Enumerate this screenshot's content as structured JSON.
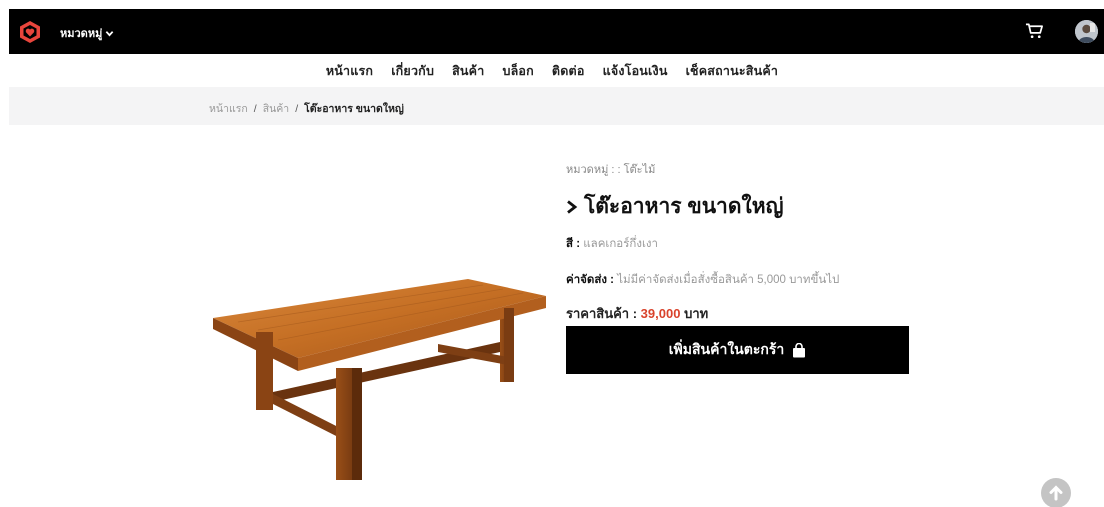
{
  "topbar": {
    "category_label": "หมวดหมู่",
    "logo_color": "#e8453c"
  },
  "nav": {
    "items": [
      "หน้าแรก",
      "เกี่ยวกับ",
      "สินค้า",
      "บล็อก",
      "ติดต่อ",
      "แจ้งโอนเงิน",
      "เช็คสถานะสินค้า"
    ]
  },
  "breadcrumb": {
    "home": "หน้าแรก",
    "sep": "/",
    "products": "สินค้า",
    "current": "โต๊ะอาหาร ขนาดใหญ่"
  },
  "product": {
    "category": "หมวดหมู่ : : โต๊ะไม้",
    "title": "โต๊ะอาหาร ขนาดใหญ่",
    "color_label": "สี :",
    "color_value": "แลคเกอร์กึ่งเงา",
    "shipping_label": "ค่าจัดส่ง :",
    "shipping_value": "ไม่มีค่าจัดส่งเมื่อสั่งซื้อสินค้า 5,000 บาทขึ้นไป",
    "price_label": "ราคาสินค้า :",
    "price_value": "39,000",
    "price_unit": "บาท",
    "add_to_cart": "เพิ่มสินค้าในตะกร้า"
  },
  "colors": {
    "accent_price": "#d9432c",
    "bar": "#000000"
  }
}
